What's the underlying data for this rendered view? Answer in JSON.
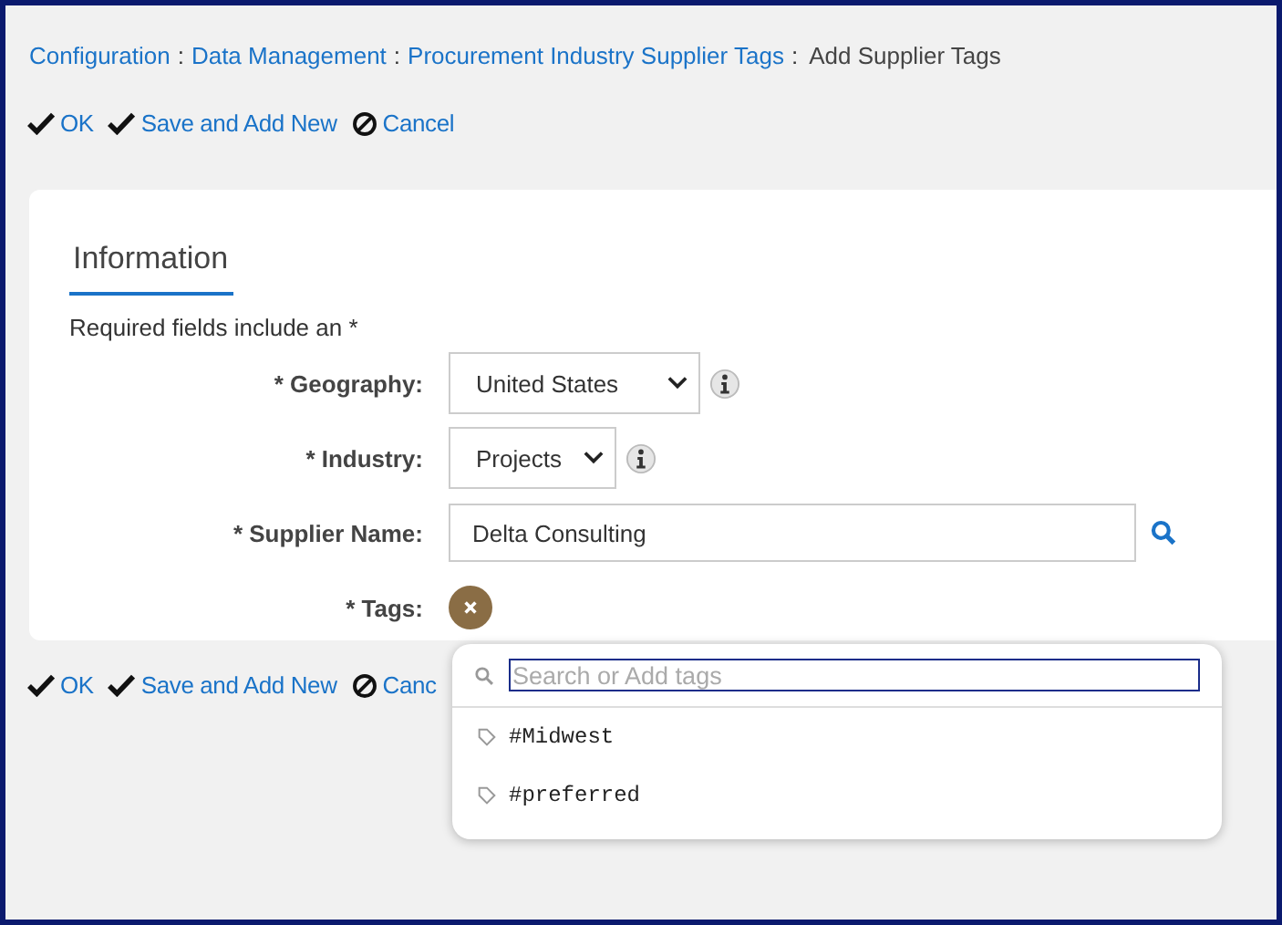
{
  "breadcrumb": [
    {
      "label": "Configuration",
      "kind": "link"
    },
    {
      "label": "Data Management",
      "kind": "link"
    },
    {
      "label": "Procurement Industry Supplier Tags",
      "kind": "link"
    },
    {
      "label": "Add Supplier Tags",
      "kind": "current"
    }
  ],
  "breadcrumb_separator": ":",
  "actions_top": [
    {
      "label": "OK",
      "kind": "check"
    },
    {
      "label": "Save and Add New",
      "kind": "check"
    },
    {
      "label": "Cancel",
      "kind": "cancel"
    }
  ],
  "form": {
    "title": "Information",
    "note": "Required fields include an *",
    "fields": [
      {
        "label": "* Geography:",
        "kind": "select",
        "value": "United States",
        "info": true
      },
      {
        "label": "* Industry:",
        "kind": "select",
        "value": "Projects",
        "info": true
      },
      {
        "label": "* Supplier Name:",
        "kind": "text",
        "value": "Delta Consulting",
        "lookup": true
      },
      {
        "label": "* Tags:",
        "kind": "tags"
      }
    ]
  },
  "actions_bottom": [
    {
      "label": "OK",
      "kind": "check"
    },
    {
      "label": "Save and Add New",
      "kind": "check"
    },
    {
      "label": "Canc",
      "kind": "cancel"
    }
  ],
  "tag_dropdown": {
    "placeholder": "Search or Add tags",
    "options": [
      {
        "label": "#Midwest"
      },
      {
        "label": "#preferred"
      }
    ]
  }
}
